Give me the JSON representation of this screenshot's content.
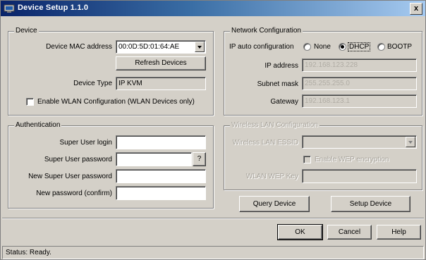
{
  "window": {
    "title": "Device Setup 1.1.0",
    "close_label": "x"
  },
  "device": {
    "legend": "Device",
    "mac_label": "Device MAC address",
    "mac_value": "00:0D:5D:01:64:AE",
    "refresh_label": "Refresh Devices",
    "type_label": "Device Type",
    "type_value": "IP KVM",
    "wlan_config_label": "Enable WLAN Configuration (WLAN Devices only)"
  },
  "network": {
    "legend": "Network Configuration",
    "auto_label": "IP auto configuration",
    "options": [
      "None",
      "DHCP",
      "BOOTP"
    ],
    "selected": "DHCP",
    "ip_label": "IP address",
    "ip_value": "192.168.123.228",
    "subnet_label": "Subnet mask",
    "subnet_value": "255.255.255.0",
    "gateway_label": "Gateway",
    "gateway_value": "192.168.123.1"
  },
  "auth": {
    "legend": "Authentication",
    "login_label": "Super User login",
    "password_label": "Super User password",
    "password_btn": "?",
    "new_password_label": "New Super User password",
    "confirm_label": "New password (confirm)"
  },
  "wireless": {
    "legend": "Wireless LAN Configuration",
    "essid_label": "Wireless LAN ESSID",
    "wep_enable_label": "Enable WEP encryption",
    "wep_key_label": "WLAN WEP Key"
  },
  "actions": {
    "query": "Query Device",
    "setup": "Setup Device"
  },
  "dialog": {
    "ok": "OK",
    "cancel": "Cancel",
    "help": "Help"
  },
  "status": {
    "text": "Status: Ready."
  },
  "colors": {
    "face": "#d4d0c8",
    "title_start": "#0a246a",
    "title_end": "#a6caf0"
  }
}
